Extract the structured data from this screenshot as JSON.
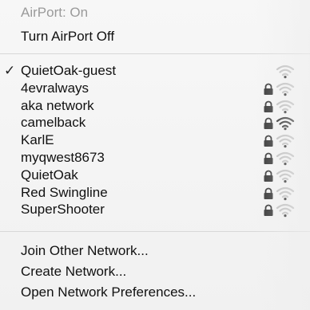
{
  "status": {
    "airport_status": "AirPort: On",
    "toggle_label": "Turn AirPort Off"
  },
  "networks": [
    {
      "name": "QuietOak-guest",
      "checked": true,
      "locked": false,
      "strength": "weak",
      "checkmark": "✓"
    },
    {
      "name": "4evralways",
      "checked": false,
      "locked": true,
      "strength": "weak"
    },
    {
      "name": "aka network",
      "checked": false,
      "locked": true,
      "strength": "weak"
    },
    {
      "name": "camelback",
      "checked": false,
      "locked": true,
      "strength": "strong"
    },
    {
      "name": "KarlE",
      "checked": false,
      "locked": true,
      "strength": "weak"
    },
    {
      "name": "myqwest8673",
      "checked": false,
      "locked": true,
      "strength": "weak"
    },
    {
      "name": "QuietOak",
      "checked": false,
      "locked": true,
      "strength": "weak"
    },
    {
      "name": "Red Swingline",
      "checked": false,
      "locked": true,
      "strength": "weak"
    },
    {
      "name": "SuperShooter",
      "checked": false,
      "locked": true,
      "strength": "weak"
    }
  ],
  "actions": {
    "join_other": "Join Other Network...",
    "create": "Create Network...",
    "preferences": "Open Network Preferences..."
  },
  "icons": {
    "lock": "lock-icon",
    "wifi": "wifi-signal-icon"
  },
  "colors": {
    "menu_bg": "#f4f4f4",
    "disabled_text": "#9a9a9a",
    "wifi_strong": "#222222",
    "wifi_weak": "#bdbdbd"
  }
}
